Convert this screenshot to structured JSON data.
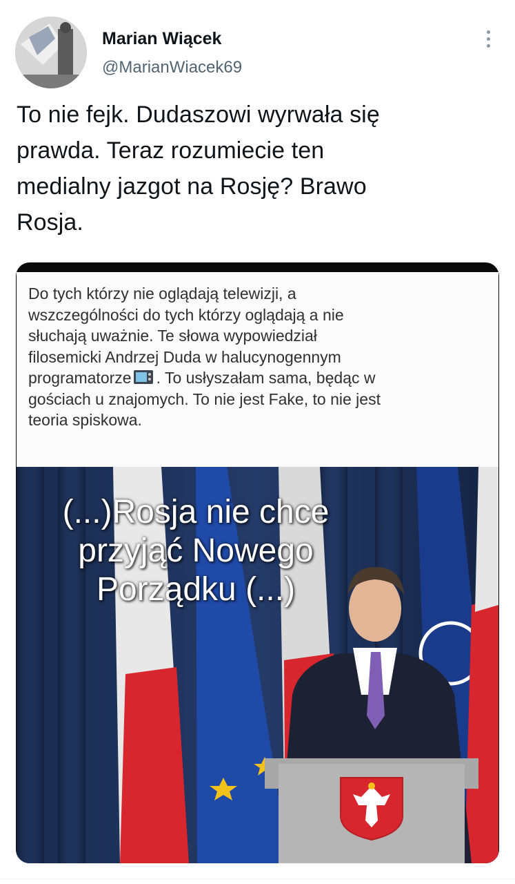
{
  "author": {
    "display_name": "Marian Wiącek",
    "handle": "@MarianWiacek69"
  },
  "tweet": {
    "text_lines": [
      "To nie fejk. Dudaszowi wyrwała się",
      "prawda. Teraz rozumiecie ten",
      "medialny jazgot na Rosję? Brawo",
      "Rosja."
    ]
  },
  "media": {
    "note_lines": [
      "Do tych którzy nie oglądają telewizji, a",
      "wszczególności do tych którzy oglądają a nie",
      "słuchają uważnie. Te słowa wypowiedział",
      "filosemicki Andrzej Duda w halucynogennym",
      "programatorze",
      ". To usłyszałam sama, będąc w",
      "gościach u znajomych. To nie jest Fake, to nie jest",
      "teoria spiskowa."
    ],
    "overlay_lines": [
      "(...)Rosja nie chce",
      "przyjąć  Nowego",
      "Porządku (...)"
    ],
    "icons": [
      "television-emoji",
      "polish-eagle-emblem",
      "eu-stars",
      "nato-emblem"
    ]
  },
  "colors": {
    "text": "#0f1419",
    "secondary": "#536471",
    "flag_red": "#d8262e",
    "eu_blue": "#1f4aa8"
  }
}
